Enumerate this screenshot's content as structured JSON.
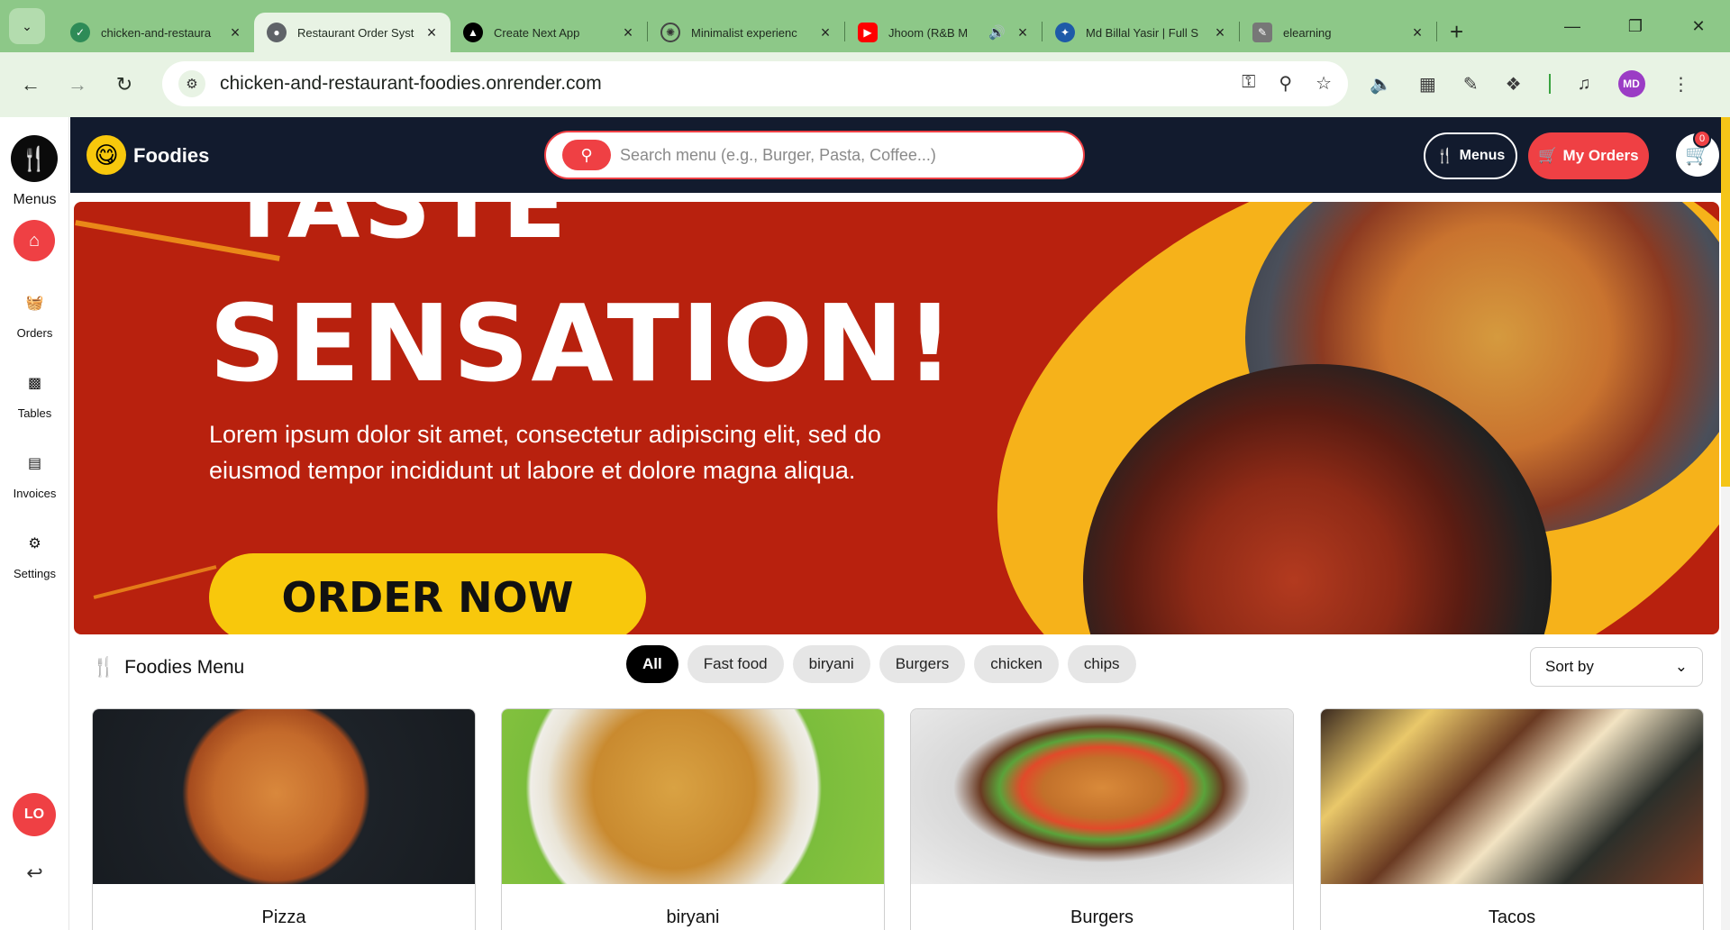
{
  "browser": {
    "tabs": [
      {
        "title": "chicken-and-restaura",
        "favicon_color": "#2e8b57"
      },
      {
        "title": "Restaurant Order Syst",
        "favicon_color": "#5f6368",
        "active": true
      },
      {
        "title": "Create Next App",
        "favicon_color": "#000000"
      },
      {
        "title": "Minimalist experienc",
        "favicon_color": "#555555"
      },
      {
        "title": "Jhoom (R&B M",
        "favicon_color": "#ff0000",
        "audio": true
      },
      {
        "title": "Md Billal Yasir | Full S",
        "favicon_color": "#1e5aa8"
      },
      {
        "title": "elearning",
        "favicon_color": "#777777"
      }
    ],
    "url": "chicken-and-restaurant-foodies.onrender.com",
    "profile_initials": "MD"
  },
  "sidebar": {
    "menus_label": "Menus",
    "items": [
      {
        "label": "Orders",
        "icon": "basket-icon"
      },
      {
        "label": "Tables",
        "icon": "table-icon"
      },
      {
        "label": "Invoices",
        "icon": "invoice-icon"
      },
      {
        "label": "Settings",
        "icon": "gear-icon"
      }
    ],
    "avatar_initials": "LO"
  },
  "header": {
    "brand": "Foodies",
    "search_placeholder": "Search menu (e.g., Burger, Pasta, Coffee...)",
    "menus_button": "Menus",
    "orders_button": "My Orders",
    "cart_count": "0"
  },
  "banner": {
    "title_top": "TASTE",
    "title": "SENSATION!",
    "subtitle": "Lorem ipsum dolor sit amet, consectetur adipiscing elit, sed do eiusmod tempor incididunt ut labore et dolore magna aliqua.",
    "cta": "ORDER NOW"
  },
  "menu": {
    "title": "Foodies Menu",
    "filters": [
      "All",
      "Fast food",
      "biryani",
      "Burgers",
      "chicken",
      "chips"
    ],
    "active_filter": "All",
    "sort_label": "Sort by",
    "items": [
      {
        "name": "Pizza"
      },
      {
        "name": "biryani"
      },
      {
        "name": "Burgers"
      },
      {
        "name": "Tacos"
      }
    ]
  },
  "colors": {
    "accent_red": "#ef4044",
    "header_navy": "#121b2e",
    "banner_red": "#b8210e",
    "brand_yellow": "#f8c80c",
    "chrome_green": "#8dc888"
  }
}
